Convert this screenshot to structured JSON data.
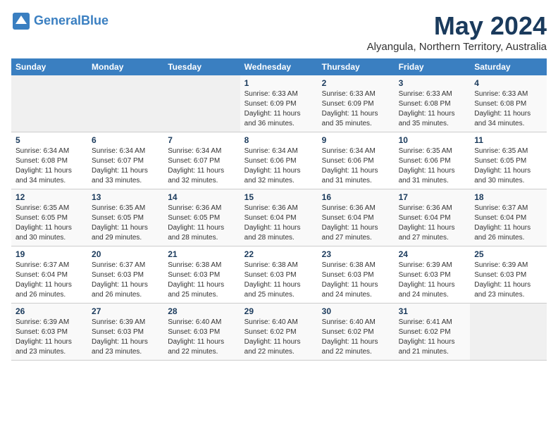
{
  "logo": {
    "line1": "General",
    "line2": "Blue"
  },
  "title": "May 2024",
  "location": "Alyangula, Northern Territory, Australia",
  "days_of_week": [
    "Sunday",
    "Monday",
    "Tuesday",
    "Wednesday",
    "Thursday",
    "Friday",
    "Saturday"
  ],
  "weeks": [
    [
      {
        "num": "",
        "info": ""
      },
      {
        "num": "",
        "info": ""
      },
      {
        "num": "",
        "info": ""
      },
      {
        "num": "1",
        "info": "Sunrise: 6:33 AM\nSunset: 6:09 PM\nDaylight: 11 hours\nand 36 minutes."
      },
      {
        "num": "2",
        "info": "Sunrise: 6:33 AM\nSunset: 6:09 PM\nDaylight: 11 hours\nand 35 minutes."
      },
      {
        "num": "3",
        "info": "Sunrise: 6:33 AM\nSunset: 6:08 PM\nDaylight: 11 hours\nand 35 minutes."
      },
      {
        "num": "4",
        "info": "Sunrise: 6:33 AM\nSunset: 6:08 PM\nDaylight: 11 hours\nand 34 minutes."
      }
    ],
    [
      {
        "num": "5",
        "info": "Sunrise: 6:34 AM\nSunset: 6:08 PM\nDaylight: 11 hours\nand 34 minutes."
      },
      {
        "num": "6",
        "info": "Sunrise: 6:34 AM\nSunset: 6:07 PM\nDaylight: 11 hours\nand 33 minutes."
      },
      {
        "num": "7",
        "info": "Sunrise: 6:34 AM\nSunset: 6:07 PM\nDaylight: 11 hours\nand 32 minutes."
      },
      {
        "num": "8",
        "info": "Sunrise: 6:34 AM\nSunset: 6:06 PM\nDaylight: 11 hours\nand 32 minutes."
      },
      {
        "num": "9",
        "info": "Sunrise: 6:34 AM\nSunset: 6:06 PM\nDaylight: 11 hours\nand 31 minutes."
      },
      {
        "num": "10",
        "info": "Sunrise: 6:35 AM\nSunset: 6:06 PM\nDaylight: 11 hours\nand 31 minutes."
      },
      {
        "num": "11",
        "info": "Sunrise: 6:35 AM\nSunset: 6:05 PM\nDaylight: 11 hours\nand 30 minutes."
      }
    ],
    [
      {
        "num": "12",
        "info": "Sunrise: 6:35 AM\nSunset: 6:05 PM\nDaylight: 11 hours\nand 30 minutes."
      },
      {
        "num": "13",
        "info": "Sunrise: 6:35 AM\nSunset: 6:05 PM\nDaylight: 11 hours\nand 29 minutes."
      },
      {
        "num": "14",
        "info": "Sunrise: 6:36 AM\nSunset: 6:05 PM\nDaylight: 11 hours\nand 28 minutes."
      },
      {
        "num": "15",
        "info": "Sunrise: 6:36 AM\nSunset: 6:04 PM\nDaylight: 11 hours\nand 28 minutes."
      },
      {
        "num": "16",
        "info": "Sunrise: 6:36 AM\nSunset: 6:04 PM\nDaylight: 11 hours\nand 27 minutes."
      },
      {
        "num": "17",
        "info": "Sunrise: 6:36 AM\nSunset: 6:04 PM\nDaylight: 11 hours\nand 27 minutes."
      },
      {
        "num": "18",
        "info": "Sunrise: 6:37 AM\nSunset: 6:04 PM\nDaylight: 11 hours\nand 26 minutes."
      }
    ],
    [
      {
        "num": "19",
        "info": "Sunrise: 6:37 AM\nSunset: 6:04 PM\nDaylight: 11 hours\nand 26 minutes."
      },
      {
        "num": "20",
        "info": "Sunrise: 6:37 AM\nSunset: 6:03 PM\nDaylight: 11 hours\nand 26 minutes."
      },
      {
        "num": "21",
        "info": "Sunrise: 6:38 AM\nSunset: 6:03 PM\nDaylight: 11 hours\nand 25 minutes."
      },
      {
        "num": "22",
        "info": "Sunrise: 6:38 AM\nSunset: 6:03 PM\nDaylight: 11 hours\nand 25 minutes."
      },
      {
        "num": "23",
        "info": "Sunrise: 6:38 AM\nSunset: 6:03 PM\nDaylight: 11 hours\nand 24 minutes."
      },
      {
        "num": "24",
        "info": "Sunrise: 6:39 AM\nSunset: 6:03 PM\nDaylight: 11 hours\nand 24 minutes."
      },
      {
        "num": "25",
        "info": "Sunrise: 6:39 AM\nSunset: 6:03 PM\nDaylight: 11 hours\nand 23 minutes."
      }
    ],
    [
      {
        "num": "26",
        "info": "Sunrise: 6:39 AM\nSunset: 6:03 PM\nDaylight: 11 hours\nand 23 minutes."
      },
      {
        "num": "27",
        "info": "Sunrise: 6:39 AM\nSunset: 6:03 PM\nDaylight: 11 hours\nand 23 minutes."
      },
      {
        "num": "28",
        "info": "Sunrise: 6:40 AM\nSunset: 6:03 PM\nDaylight: 11 hours\nand 22 minutes."
      },
      {
        "num": "29",
        "info": "Sunrise: 6:40 AM\nSunset: 6:02 PM\nDaylight: 11 hours\nand 22 minutes."
      },
      {
        "num": "30",
        "info": "Sunrise: 6:40 AM\nSunset: 6:02 PM\nDaylight: 11 hours\nand 22 minutes."
      },
      {
        "num": "31",
        "info": "Sunrise: 6:41 AM\nSunset: 6:02 PM\nDaylight: 11 hours\nand 21 minutes."
      },
      {
        "num": "",
        "info": ""
      }
    ]
  ]
}
